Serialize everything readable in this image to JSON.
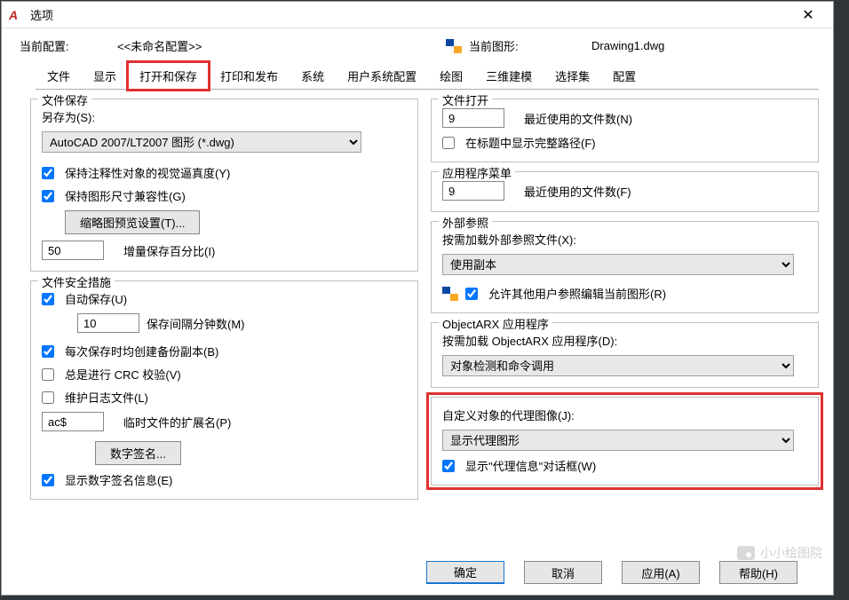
{
  "window": {
    "title": "选项",
    "app_letter": "A"
  },
  "profile": {
    "label": "当前配置:",
    "value": "<<未命名配置>>",
    "drawing_label": "当前图形:",
    "drawing_value": "Drawing1.dwg"
  },
  "tabs": [
    "文件",
    "显示",
    "打开和保存",
    "打印和发布",
    "系统",
    "用户系统配置",
    "绘图",
    "三维建模",
    "选择集",
    "配置"
  ],
  "file_save": {
    "title": "文件保存",
    "save_as": "另存为(S):",
    "format": "AutoCAD 2007/LT2007 图形 (*.dwg)",
    "cb_visual": "保持注释性对象的视觉逼真度(Y)",
    "cb_compat": "保持图形尺寸兼容性(G)",
    "thumb_btn": "缩略图预览设置(T)...",
    "percent_val": "50",
    "percent_label": "增量保存百分比(I)"
  },
  "file_safe": {
    "title": "文件安全措施",
    "cb_autosave": "自动保存(U)",
    "minutes_val": "10",
    "minutes_label": "保存间隔分钟数(M)",
    "cb_backup": "每次保存时均创建备份副本(B)",
    "cb_crc": "总是进行 CRC 校验(V)",
    "cb_log": "维护日志文件(L)",
    "ext_val": "ac$",
    "ext_label": "临时文件的扩展名(P)",
    "sign_btn": "数字签名...",
    "cb_showsign": "显示数字签名信息(E)"
  },
  "file_open": {
    "title": "文件打开",
    "recent_val": "9",
    "recent_label": "最近使用的文件数(N)",
    "cb_fullpath": "在标题中显示完整路径(F)"
  },
  "app_menu": {
    "title": "应用程序菜单",
    "recent_val": "9",
    "recent_label": "最近使用的文件数(F)"
  },
  "xref": {
    "title": "外部参照",
    "load_label": "按需加载外部参照文件(X):",
    "load_val": "使用副本",
    "cb_allow": "允许其他用户参照编辑当前图形(R)"
  },
  "objectarx": {
    "title": "ObjectARX 应用程序",
    "load_label": "按需加载 ObjectARX 应用程序(D):",
    "load_val": "对象检测和命令调用"
  },
  "proxy": {
    "title": "自定义对象的代理图像(J):",
    "val": "显示代理图形",
    "cb_show": "显示\"代理信息\"对话框(W)"
  },
  "footer": {
    "ok": "确定",
    "cancel": "取消",
    "apply": "应用(A)",
    "help": "帮助(H)"
  },
  "watermark": "小小绘图院"
}
